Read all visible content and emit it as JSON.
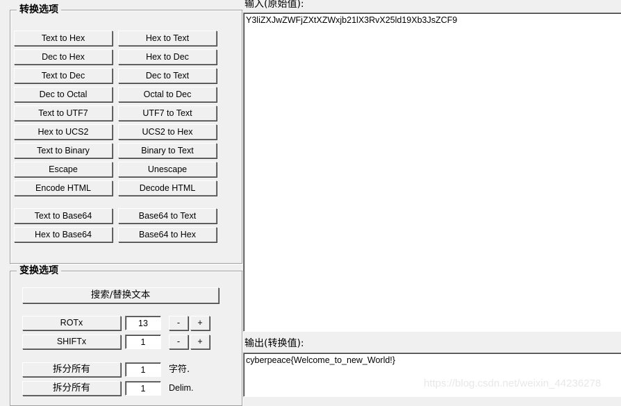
{
  "convert_panel": {
    "title": "转换选项",
    "buttons_left": [
      "Text to Hex",
      "Dec to Hex",
      "Text to Dec",
      "Dec to Octal",
      "Text to UTF7",
      "Hex to UCS2",
      "Text to Binary",
      "Escape",
      "Encode HTML",
      "Text to Base64",
      "Hex to Base64"
    ],
    "buttons_right": [
      "Hex to Text",
      "Hex to Dec",
      "Dec to Text",
      "Octal to Dec",
      "UTF7 to Text",
      "UCS2 to Hex",
      "Binary to Text",
      "Unescape",
      "Decode HTML",
      "Base64 to Text",
      "Base64 to Hex"
    ]
  },
  "transform_panel": {
    "title": "变换选项",
    "search_replace_label": "搜索/替换文本",
    "rows": [
      {
        "label": "ROTx",
        "value": "13",
        "minus": "-",
        "plus": "+",
        "unit": ""
      },
      {
        "label": "SHIFTx",
        "value": "1",
        "minus": "-",
        "plus": "+",
        "unit": ""
      },
      {
        "label": "拆分所有",
        "value": "1",
        "unit": "字符."
      },
      {
        "label": "拆分所有",
        "value": "1",
        "unit": "Delim."
      }
    ]
  },
  "input_field": {
    "label": "输入(原始值):",
    "value": "Y3liZXJwZWFjZXtXZWxjb21lX3RvX25ld19Xb3JsZCF9"
  },
  "output_field": {
    "label": "输出(转换值):",
    "value": "cyberpeace{Welcome_to_new_World!}"
  },
  "watermark": {
    "text": "https://blog.csdn.net/weixin_44236278"
  },
  "colors": {
    "face": "#f0f0f0",
    "shadow": "#808080",
    "dark_shadow": "#404040",
    "highlight": "#ffffff",
    "field_bg": "#ffffff",
    "text": "#000000",
    "watermark": "#e8e8e8"
  }
}
